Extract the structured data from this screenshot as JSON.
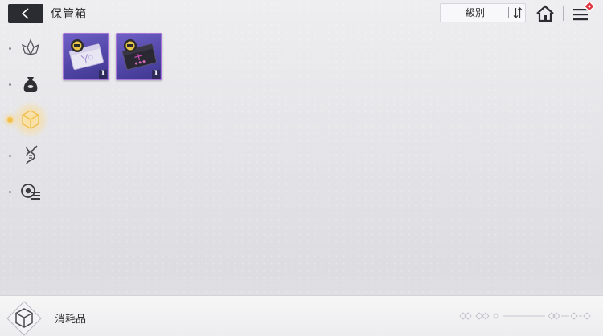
{
  "header": {
    "title": "保管箱",
    "back_icon": "back-arrow-icon",
    "sort_label": "級別",
    "sort_order_icon": "sort-order-icon",
    "home_icon": "home-icon",
    "menu_icon": "menu-icon",
    "menu_badge_color": "#e0343f"
  },
  "sidebar": {
    "items": [
      {
        "icon": "crystal-icon",
        "active": false
      },
      {
        "icon": "pouch-icon",
        "active": false
      },
      {
        "icon": "cube-icon",
        "active": true
      },
      {
        "icon": "dna-icon",
        "active": false
      },
      {
        "icon": "disc-list-icon",
        "active": false
      }
    ],
    "active_color": "#f2c04c"
  },
  "inventory": {
    "items": [
      {
        "name": "item-ticket-white",
        "count": "1"
      },
      {
        "name": "item-ticket-black",
        "count": "1"
      }
    ],
    "rarity_color": "#a576d8"
  },
  "footer": {
    "category_icon": "cube-icon",
    "category_label": "消耗品"
  }
}
